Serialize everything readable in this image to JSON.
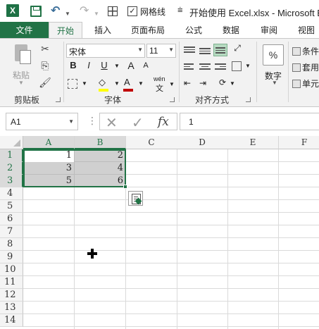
{
  "app": {
    "logo": "X",
    "window_title": "开始使用 Excel.xlsx - Microsoft E",
    "gridlines_label": "网格线",
    "gridlines_checked": true,
    "accent": "#217346"
  },
  "quick_access": [
    {
      "name": "save-icon",
      "interactable": true
    },
    {
      "name": "undo-icon",
      "glyph": "↶"
    },
    {
      "name": "redo-icon",
      "glyph": "↷"
    },
    {
      "name": "gridlines-icon"
    },
    {
      "name": "gridlines-checkbox",
      "glyph": "✓"
    },
    {
      "name": "customize-qat-icon",
      "glyph": "⩧"
    }
  ],
  "tabs": {
    "file": "文件",
    "home": "开始",
    "insert": "插入",
    "page_layout": "页面布局",
    "formulas": "公式",
    "data": "数据",
    "review": "审阅",
    "view": "视图"
  },
  "ribbon": {
    "clipboard": {
      "label": "剪贴板",
      "paste": "粘贴",
      "cut_icon": "✂",
      "copy_icon": "⎘",
      "format_painter_icon": "🖌"
    },
    "font": {
      "label": "字体",
      "font_name": "宋体",
      "font_size": "11",
      "bold": "B",
      "italic": "I",
      "underline": "U",
      "grow": "A",
      "shrink": "A",
      "font_color": "A",
      "phonetic": "wén"
    },
    "alignment": {
      "label": "对齐方式"
    },
    "number": {
      "label": "数字",
      "icon": "%"
    },
    "styles": {
      "conditional": "条件",
      "table": "套用",
      "cell": "单元"
    }
  },
  "formula_bar": {
    "name_box": "A1",
    "cancel_icon": "✕",
    "enter_icon": "✓",
    "fx": "fx",
    "value": "1"
  },
  "sheet": {
    "columns": [
      "A",
      "B",
      "C",
      "D",
      "E",
      "F"
    ],
    "rows": [
      "1",
      "2",
      "3",
      "4",
      "5",
      "6",
      "7",
      "8",
      "9",
      "10",
      "11",
      "12",
      "13",
      "14"
    ],
    "cells": {
      "A1": "1",
      "B1": "2",
      "A2": "3",
      "B2": "4",
      "A3": "5",
      "B3": "6"
    }
  }
}
